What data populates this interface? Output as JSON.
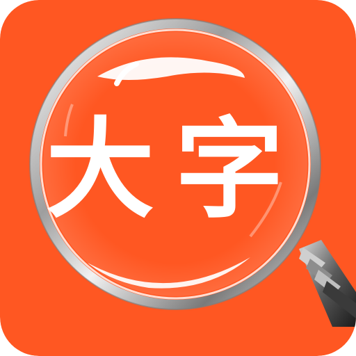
{
  "app_icon": {
    "glyph_left": "大",
    "glyph_right": "字",
    "icon_name": "magnifier-icon",
    "colors": {
      "background": "#FF5722",
      "glyph": "#FFFFFF",
      "lens_rim": "#C8C8C8",
      "handle": "#2A2A2A"
    }
  }
}
